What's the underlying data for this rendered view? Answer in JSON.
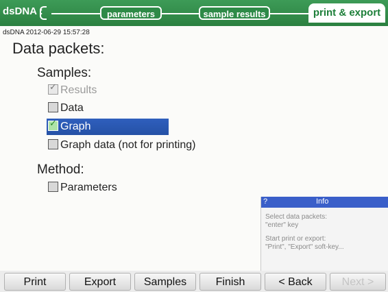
{
  "wizard": {
    "app": "dsDNA :",
    "steps": [
      "parameters",
      "sample results",
      "print & export"
    ]
  },
  "subtitle": "dsDNA 2012-06-29 15:57:28",
  "heading": "Data packets:",
  "samples": {
    "label": "Samples:",
    "options": [
      {
        "label": "Results",
        "checked": true,
        "enabled": false
      },
      {
        "label": "Data",
        "checked": false,
        "enabled": true
      },
      {
        "label": "Graph",
        "checked": true,
        "enabled": true,
        "selected": true
      },
      {
        "label": "Graph data (not for printing)",
        "checked": false,
        "enabled": true
      }
    ]
  },
  "method": {
    "label": "Method:",
    "options": [
      {
        "label": "Parameters",
        "checked": false,
        "enabled": true
      }
    ]
  },
  "info": {
    "help_glyph": "?",
    "title": "Info",
    "line1": "Select data packets:",
    "line2": "\"enter\" key",
    "line3": "Start print or export:",
    "line4": "\"Print\", \"Export\" soft-key..."
  },
  "softkeys": [
    "Print",
    "Export",
    "Samples",
    "Finish",
    "< Back",
    "Next >"
  ],
  "colors": {
    "header_green": "#2e8a47",
    "selection_blue": "#2b58b3",
    "info_blue": "#3a5fc9"
  }
}
